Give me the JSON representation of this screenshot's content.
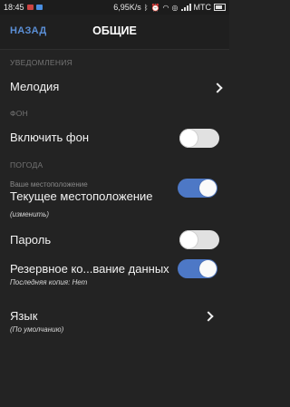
{
  "status": {
    "time": "18:45",
    "speed": "6,95K/s",
    "carrier": "МТС"
  },
  "header": {
    "back_label": "НАЗАД",
    "title": "ОБЩИЕ"
  },
  "sections": {
    "notifications": "УВЕДОМЛЕНИЯ",
    "background": "ФОН",
    "weather": "ПОГОДА"
  },
  "rows": {
    "melody": {
      "label": "Мелодия"
    },
    "enable_bg": {
      "label": "Включить фон",
      "on": false
    },
    "location": {
      "caption": "Ваше местоположение",
      "label": "Текущее местоположение",
      "sub": "(изменить)",
      "on": true
    },
    "password": {
      "label": "Пароль",
      "on": false
    },
    "backup": {
      "label": "Резервное ко...вание данных",
      "sub": "Последняя копия: Нет",
      "on": true
    },
    "language": {
      "label": "Язык",
      "sub": "(По умолчанию)"
    }
  },
  "colors": {
    "background": "#232323",
    "accent": "#5b8fd6",
    "toggle_on": "#4d78c6",
    "toggle_off": "#e1e1e1"
  },
  "icons": [
    "chevron-right-icon",
    "bluetooth-icon",
    "alarm-icon",
    "wifi-icon",
    "signal-icon",
    "battery-icon"
  ]
}
